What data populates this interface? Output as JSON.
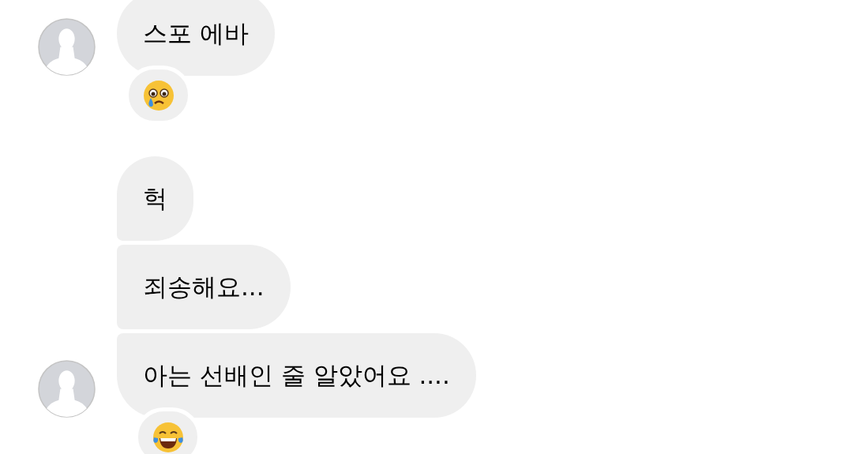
{
  "messages": [
    {
      "text": "스포 에바",
      "avatar": true,
      "reaction": {
        "kind": "crying"
      }
    },
    {
      "text": "헉",
      "avatar": false
    },
    {
      "text": "죄송해요...",
      "avatar": false
    },
    {
      "text": "아는 선배인 줄 알았어요 ....",
      "avatar": true,
      "reaction": {
        "kind": "laughing"
      }
    }
  ]
}
